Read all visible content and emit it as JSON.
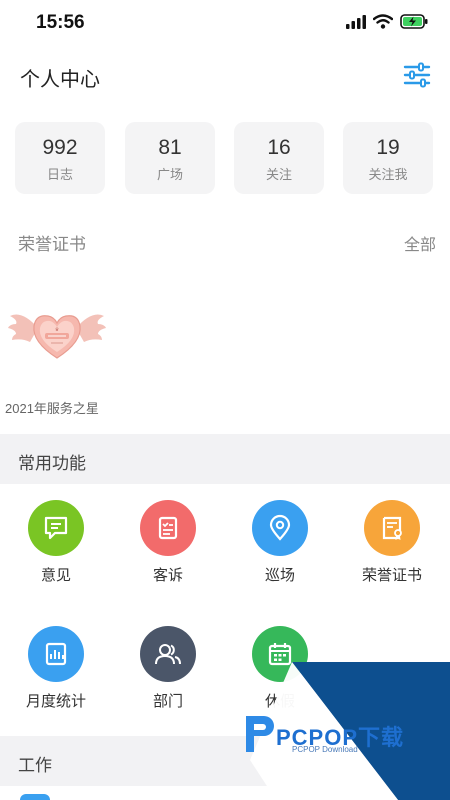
{
  "status_bar": {
    "time": "15:56"
  },
  "header": {
    "title": "个人中心",
    "settings_icon": "sliders-icon"
  },
  "stats": [
    {
      "value": "992",
      "label": "日志"
    },
    {
      "value": "81",
      "label": "广场"
    },
    {
      "value": "16",
      "label": "关注"
    },
    {
      "value": "19",
      "label": "关注我"
    }
  ],
  "honors": {
    "title": "荣誉证书",
    "all_link": "全部",
    "badge_caption": "2021年服务之星"
  },
  "common_functions": {
    "title": "常用功能",
    "items": [
      {
        "label": "意见",
        "icon": "message-icon",
        "color": "#7ac524"
      },
      {
        "label": "客诉",
        "icon": "clipboard-icon",
        "color": "#f26b6b"
      },
      {
        "label": "巡场",
        "icon": "location-pin-icon",
        "color": "#3aa0f0"
      },
      {
        "label": "荣誉证书",
        "icon": "certificate-icon",
        "color": "#f7a53a"
      },
      {
        "label": "月度统计",
        "icon": "bar-chart-icon",
        "color": "#3aa0f0"
      },
      {
        "label": "部门",
        "icon": "users-icon",
        "color": "#4b5669"
      },
      {
        "label": "休假",
        "icon": "calendar-icon",
        "color": "#36b85a"
      }
    ]
  },
  "work": {
    "title": "工作"
  },
  "watermark": {
    "brand": "PCPOP下载",
    "sub": "PCPOP Download"
  }
}
